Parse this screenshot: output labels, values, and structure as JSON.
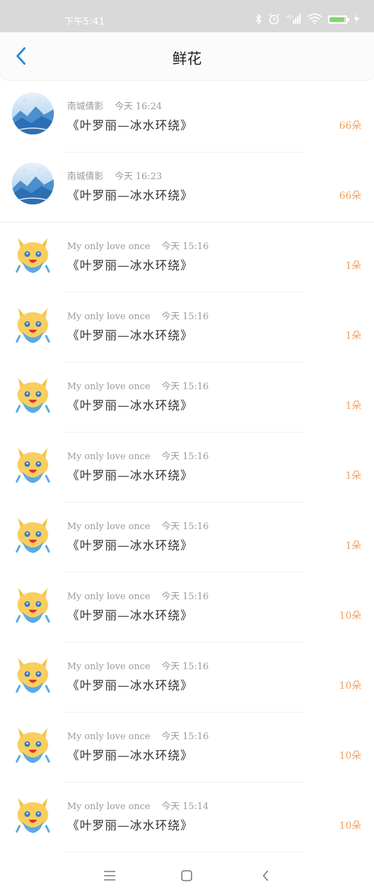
{
  "status_bar": {
    "time": "下午5:41",
    "battery_level": 0.85,
    "battery_color": "#7ed66e"
  },
  "header": {
    "title": "鲜花",
    "back_icon": "chevron-left-icon",
    "accent": "#2b8cd8"
  },
  "items": [
    {
      "user": "南城倩影",
      "time": "今天 16:24",
      "text": "《叶罗丽—冰水环绕》",
      "count": "66朵",
      "avatar": "landscape"
    },
    {
      "user": "南城倩影",
      "time": "今天 16:23",
      "text": "《叶罗丽—冰水环绕》",
      "count": "66朵",
      "avatar": "landscape"
    },
    {
      "user": "My only love once",
      "time": "今天 15:16",
      "text": "《叶罗丽—冰水环绕》",
      "count": "1朵",
      "avatar": "fox"
    },
    {
      "user": "My only love once",
      "time": "今天 15:16",
      "text": "《叶罗丽—冰水环绕》",
      "count": "1朵",
      "avatar": "fox"
    },
    {
      "user": "My only love once",
      "time": "今天 15:16",
      "text": "《叶罗丽—冰水环绕》",
      "count": "1朵",
      "avatar": "fox"
    },
    {
      "user": "My only love once",
      "time": "今天 15:16",
      "text": "《叶罗丽—冰水环绕》",
      "count": "1朵",
      "avatar": "fox"
    },
    {
      "user": "My only love once",
      "time": "今天 15:16",
      "text": "《叶罗丽—冰水环绕》",
      "count": "1朵",
      "avatar": "fox"
    },
    {
      "user": "My only love once",
      "time": "今天 15:16",
      "text": "《叶罗丽—冰水环绕》",
      "count": "10朵",
      "avatar": "fox"
    },
    {
      "user": "My only love once",
      "time": "今天 15:16",
      "text": "《叶罗丽—冰水环绕》",
      "count": "10朵",
      "avatar": "fox"
    },
    {
      "user": "My only love once",
      "time": "今天 15:16",
      "text": "《叶罗丽—冰水环绕》",
      "count": "10朵",
      "avatar": "fox"
    },
    {
      "user": "My only love once",
      "time": "今天 15:14",
      "text": "《叶罗丽—冰水环绕》",
      "count": "10朵",
      "avatar": "fox"
    }
  ],
  "nav_bar": {
    "menu_icon": "menu-icon",
    "home_icon": "home-square-icon",
    "back_icon": "back-chevron-icon"
  }
}
